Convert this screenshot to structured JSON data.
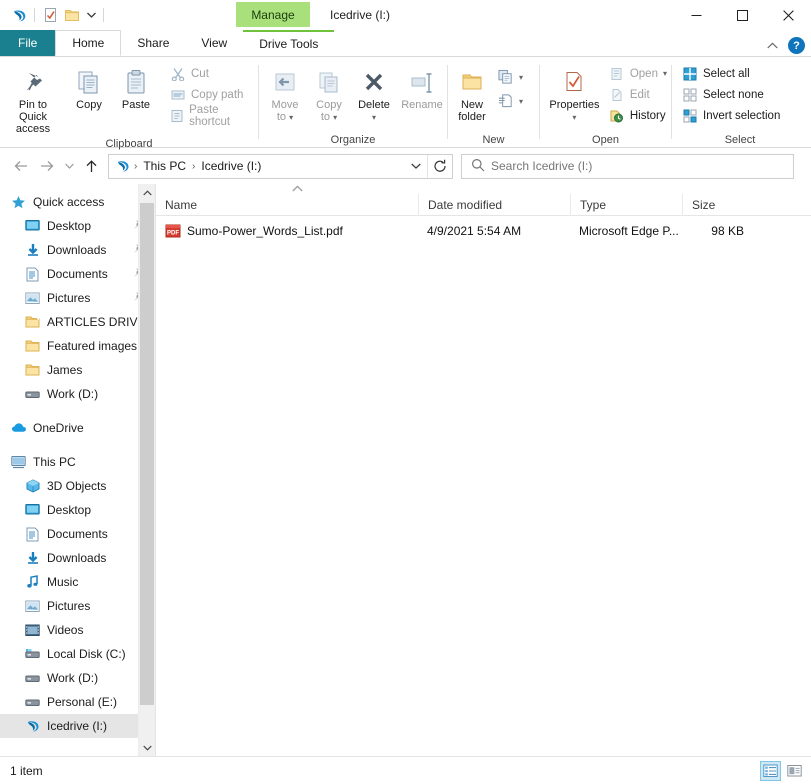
{
  "window": {
    "title": "Icedrive (I:)",
    "contextual_tab": "Manage",
    "minimize": "Minimize",
    "maximize": "Maximize",
    "close": "Close",
    "help": "?",
    "collapse_ribbon": "Collapse the Ribbon"
  },
  "quick_access_toolbar": {
    "app_icon": "icedrive-logo-icon",
    "properties": "Properties",
    "new_folder": "New folder",
    "customize": "Customize Quick Access Toolbar"
  },
  "tabs": [
    {
      "label": "File",
      "state": "file"
    },
    {
      "label": "Home",
      "state": "active"
    },
    {
      "label": "Share",
      "state": "normal"
    },
    {
      "label": "View",
      "state": "normal"
    },
    {
      "label": "Drive Tools",
      "state": "contextual"
    }
  ],
  "ribbon": {
    "groups": [
      {
        "name": "Clipboard",
        "label": "Clipboard",
        "big": [
          {
            "label": "Pin to Quick\naccess",
            "line1": "Pin to Quick",
            "line2": "access",
            "icon": "pin-icon",
            "disabled": false
          },
          {
            "label": "Copy",
            "line1": "Copy",
            "line2": "",
            "icon": "copy-icon",
            "disabled": false
          },
          {
            "label": "Paste",
            "line1": "Paste",
            "line2": "",
            "icon": "paste-icon",
            "disabled": false
          }
        ],
        "small": [
          {
            "label": "Cut",
            "icon": "cut-icon",
            "disabled": true
          },
          {
            "label": "Copy path",
            "icon": "copy-path-icon",
            "disabled": true
          },
          {
            "label": "Paste shortcut",
            "icon": "paste-shortcut-icon",
            "disabled": true
          }
        ]
      },
      {
        "name": "Organize",
        "label": "Organize",
        "big": [
          {
            "line1": "Move",
            "line2": "to",
            "icon": "move-to-icon",
            "disabled": true,
            "caret": true
          },
          {
            "line1": "Copy",
            "line2": "to",
            "icon": "copy-to-icon",
            "disabled": true,
            "caret": true
          },
          {
            "line1": "Delete",
            "line2": "",
            "icon": "delete-icon",
            "disabled": false,
            "caret": true
          },
          {
            "line1": "Rename",
            "line2": "",
            "icon": "rename-icon",
            "disabled": true,
            "caret": false
          }
        ]
      },
      {
        "name": "New",
        "label": "New",
        "big": [
          {
            "line1": "New",
            "line2": "folder",
            "icon": "new-folder-icon",
            "disabled": false
          }
        ],
        "stack": [
          {
            "label": "New item",
            "icon": "new-item-icon"
          },
          {
            "label": "Easy access",
            "icon": "easy-access-icon"
          }
        ]
      },
      {
        "name": "Open",
        "label": "Open",
        "big": [
          {
            "line1": "Properties",
            "line2": "",
            "icon": "properties-icon",
            "disabled": false,
            "caret": true
          }
        ],
        "small": [
          {
            "label": "Open",
            "icon": "open-icon",
            "disabled": true,
            "caret": true
          },
          {
            "label": "Edit",
            "icon": "edit-icon",
            "disabled": true
          },
          {
            "label": "History",
            "icon": "history-icon",
            "disabled": false
          }
        ]
      },
      {
        "name": "Select",
        "label": "Select",
        "small": [
          {
            "label": "Select all",
            "icon": "select-all-icon",
            "disabled": false
          },
          {
            "label": "Select none",
            "icon": "select-none-icon",
            "disabled": false
          },
          {
            "label": "Invert selection",
            "icon": "invert-selection-icon",
            "disabled": false
          }
        ]
      }
    ]
  },
  "addressbar": {
    "back": "Back",
    "forward": "Forward",
    "recent": "Recent locations",
    "up": "Up",
    "drive_icon": "icedrive-logo-icon",
    "crumbs": [
      "This PC",
      "Icedrive (I:)"
    ],
    "separator": "›",
    "dropdown": "Previous locations",
    "refresh": "Refresh"
  },
  "search": {
    "placeholder": "Search Icedrive (I:)",
    "icon": "search-icon"
  },
  "navpane": {
    "sections": [
      {
        "items": [
          {
            "label": "Quick access",
            "icon": "star-icon",
            "indent": 0,
            "pinned": false,
            "selected": false
          },
          {
            "label": "Desktop",
            "icon": "desktop-icon",
            "indent": 1,
            "pinned": true,
            "selected": false
          },
          {
            "label": "Downloads",
            "icon": "downloads-icon",
            "indent": 1,
            "pinned": true,
            "selected": false
          },
          {
            "label": "Documents",
            "icon": "documents-icon",
            "indent": 1,
            "pinned": true,
            "selected": false
          },
          {
            "label": "Pictures",
            "icon": "pictures-icon",
            "indent": 1,
            "pinned": true,
            "selected": false
          },
          {
            "label": "ARTICLES DRIVE",
            "icon": "folder-shortcut-icon",
            "indent": 1,
            "pinned": false,
            "selected": false
          },
          {
            "label": "Featured images",
            "icon": "folder-icon",
            "indent": 1,
            "pinned": false,
            "selected": false
          },
          {
            "label": "James",
            "icon": "folder-icon",
            "indent": 1,
            "pinned": false,
            "selected": false
          },
          {
            "label": "Work (D:)",
            "icon": "drive-icon",
            "indent": 1,
            "pinned": false,
            "selected": false
          }
        ]
      },
      {
        "items": [
          {
            "label": "OneDrive",
            "icon": "onedrive-icon",
            "indent": 0,
            "pinned": false,
            "selected": false
          }
        ]
      },
      {
        "items": [
          {
            "label": "This PC",
            "icon": "thispc-icon",
            "indent": 0,
            "pinned": false,
            "selected": false
          },
          {
            "label": "3D Objects",
            "icon": "3d-objects-icon",
            "indent": 1,
            "pinned": false,
            "selected": false
          },
          {
            "label": "Desktop",
            "icon": "desktop-icon",
            "indent": 1,
            "pinned": false,
            "selected": false
          },
          {
            "label": "Documents",
            "icon": "documents-icon",
            "indent": 1,
            "pinned": false,
            "selected": false
          },
          {
            "label": "Downloads",
            "icon": "downloads-icon",
            "indent": 1,
            "pinned": false,
            "selected": false
          },
          {
            "label": "Music",
            "icon": "music-icon",
            "indent": 1,
            "pinned": false,
            "selected": false
          },
          {
            "label": "Pictures",
            "icon": "pictures-icon",
            "indent": 1,
            "pinned": false,
            "selected": false
          },
          {
            "label": "Videos",
            "icon": "videos-icon",
            "indent": 1,
            "pinned": false,
            "selected": false
          },
          {
            "label": "Local Disk (C:)",
            "icon": "local-disk-icon",
            "indent": 1,
            "pinned": false,
            "selected": false
          },
          {
            "label": "Work (D:)",
            "icon": "drive-icon",
            "indent": 1,
            "pinned": false,
            "selected": false
          },
          {
            "label": "Personal (E:)",
            "icon": "drive-icon",
            "indent": 1,
            "pinned": false,
            "selected": false
          },
          {
            "label": "Icedrive (I:)",
            "icon": "icedrive-logo-icon",
            "indent": 1,
            "pinned": false,
            "selected": true
          }
        ]
      }
    ]
  },
  "filelist": {
    "sort_indicator": "ascending",
    "columns": [
      {
        "label": "Name",
        "key": "name"
      },
      {
        "label": "Date modified",
        "key": "date"
      },
      {
        "label": "Type",
        "key": "type"
      },
      {
        "label": "Size",
        "key": "size"
      }
    ],
    "rows": [
      {
        "name": "Sumo-Power_Words_List.pdf",
        "date": "4/9/2021 5:54 AM",
        "type": "Microsoft Edge P...",
        "size": "98 KB",
        "icon": "pdf-file-icon"
      }
    ]
  },
  "statusbar": {
    "item_count": "1 item",
    "views": [
      {
        "name": "details-view",
        "label": "Details view",
        "active": true
      },
      {
        "name": "large-icons-view",
        "label": "Large icons view",
        "active": false
      }
    ]
  },
  "colors": {
    "file_tab": "#1a7f8e",
    "contextual_green": "#a9e07c",
    "contextual_border": "#6fc33a",
    "selection": "#e5e5e5",
    "view_active": "#cce8f4",
    "help_blue": "#1074bc",
    "pdf_red": "#d63b2f"
  }
}
